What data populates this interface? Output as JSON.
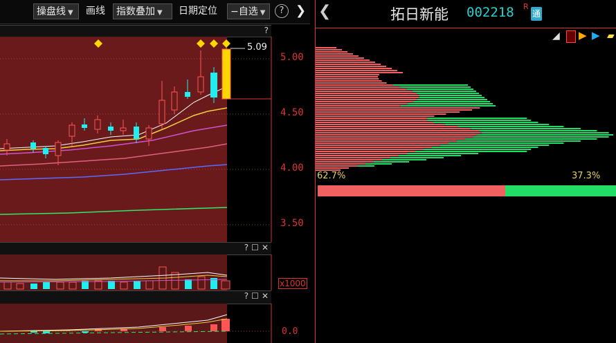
{
  "toolbar": {
    "operate_line": "操盘线",
    "draw_line": "画线",
    "index_overlay": "指数叠加",
    "date_locate": "日期定位",
    "watchlist": "自选",
    "help": "?",
    "collapse": "❯"
  },
  "main_chart": {
    "help": "?",
    "price_marker": "5.09",
    "y_axis": [
      "5.00",
      "4.50",
      "4.00",
      "3.50"
    ]
  },
  "volume_pane": {
    "help": "?",
    "scale_label": "x1000"
  },
  "indicator_pane": {
    "help": "?",
    "zero_label": "0.0"
  },
  "stock": {
    "name": "拓日新能",
    "code": "002218",
    "r_mark": "R",
    "tong_badge": "通"
  },
  "chip": {
    "profit_pct": "62.7%",
    "loss_pct": "37.3%",
    "profit_ratio": 0.627
  },
  "colors": {
    "up": "#ff6060",
    "down": "#2ee",
    "profit_red": "#f06060",
    "loss_green": "#22dd66",
    "axis": "#dd3333"
  }
}
